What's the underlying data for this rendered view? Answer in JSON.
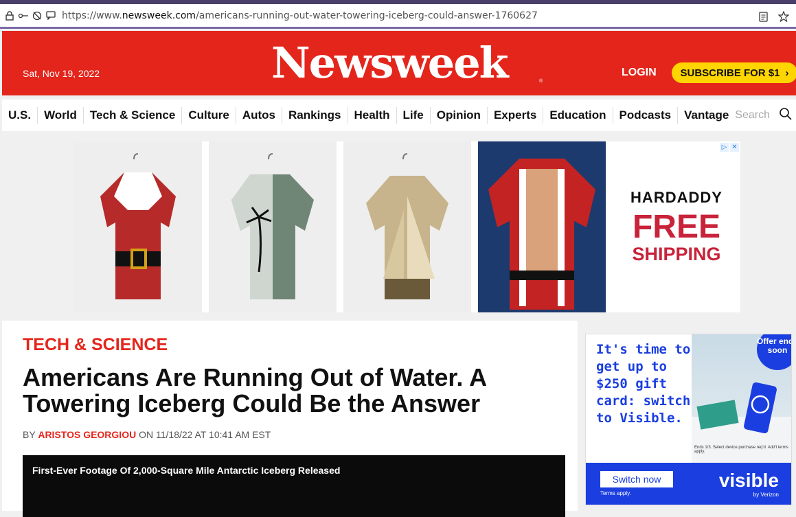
{
  "browser": {
    "url_prefix": "https://www.",
    "url_domain": "newsweek.com",
    "url_path": "/americans-running-out-water-towering-iceberg-could-answer-1760627"
  },
  "header": {
    "date": "Sat, Nov 19, 2022",
    "logo": "Newsweek",
    "logo_mark": "®",
    "login": "LOGIN",
    "subscribe": "SUBSCRIBE FOR $1",
    "subscribe_chevron": "›"
  },
  "nav": {
    "items": [
      "U.S.",
      "World",
      "Tech & Science",
      "Culture",
      "Autos",
      "Rankings",
      "Health",
      "Life",
      "Opinion",
      "Experts",
      "Education",
      "Podcasts",
      "Vantage"
    ],
    "search_placeholder": "Search"
  },
  "ad_banner": {
    "brand": "HARDADDY",
    "headline": "FREE",
    "subline": "SHIPPING",
    "choices": [
      "▷",
      "✕"
    ]
  },
  "article": {
    "section": "TECH & SCIENCE",
    "headline": "Americans Are Running Out of Water. A Towering Iceberg Could Be the Answer",
    "by": "BY",
    "author": "ARISTOS GEORGIOU",
    "date": "ON 11/18/22 AT 10:41 AM EST",
    "video_title": "First-Ever Footage Of 2,000-Square Mile Antarctic Iceberg Released"
  },
  "side_ad": {
    "headline": "It's time to get up to $250 gift card: switch to Visible.",
    "offer": "Offer ends soon",
    "fine_print": "Ends 1/3. Select device purchase req'd. Add'l terms apply.",
    "button": "Switch now",
    "terms": "Terms apply.",
    "logo": "visible",
    "by": "by Verizon"
  },
  "colors": {
    "brand_red": "#e4251b",
    "subscribe_yellow": "#ffd500",
    "visible_blue": "#1a3ee0"
  }
}
